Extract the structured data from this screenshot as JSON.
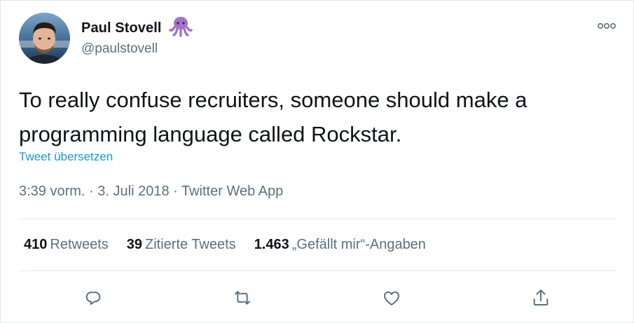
{
  "author": {
    "name": "Paul Stovell",
    "handle": "@paulstovell",
    "avatar_icon": "avatar-photo",
    "badge_icon": "octopus-emoji"
  },
  "tweet": {
    "text": "To really confuse recruiters, someone should make a programming language called Rockstar.",
    "translate_label": "Tweet übersetzen",
    "time": "3:39 vorm.",
    "date": "3. Juli 2018",
    "source": "Twitter Web App",
    "separator": "·"
  },
  "stats": {
    "retweets_count": "410",
    "retweets_label": "Retweets",
    "quotes_count": "39",
    "quotes_label": "Zitierte Tweets",
    "likes_count": "1.463",
    "likes_label": "„Gefällt mir“-Angaben"
  },
  "actions": {
    "reply_icon": "reply-icon",
    "retweet_icon": "retweet-icon",
    "like_icon": "heart-icon",
    "share_icon": "share-icon"
  },
  "colors": {
    "text": "#0f1419",
    "secondary": "#5b7083",
    "link": "#1b95e0",
    "emoji": "#a371c9",
    "divider": "#e6ecf0"
  }
}
